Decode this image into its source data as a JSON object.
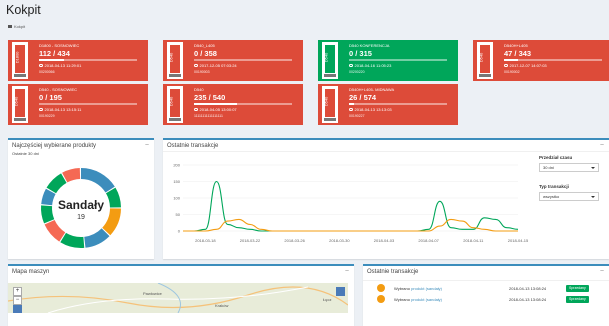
{
  "page": {
    "title": "Kokpit",
    "breadcrumb": "Kokpit"
  },
  "tiles": [
    {
      "color": "red",
      "code": "D1800",
      "name": "D1800 - SOSNOWIEC",
      "count": "112 / 434",
      "fill": 0.26,
      "timestamp": "2018-04-13 11:29:01",
      "id": "00200066"
    },
    {
      "color": "red",
      "code": "D540",
      "name": "D540_L405",
      "count": "0 / 358",
      "fill": 0.0,
      "timestamp": "2017-12-05 07:03:24",
      "id": "00190003"
    },
    {
      "color": "green",
      "code": "D540",
      "name": "D540 KONFERENCJA",
      "count": "0 / 315",
      "fill": 0.0,
      "timestamp": "2018-04-16 11:05:23",
      "id": "00200220"
    },
    {
      "color": "red",
      "code": "D540",
      "name": "D540H+L405",
      "count": "47 / 343",
      "fill": 0.14,
      "timestamp": "2017-12-07 14:07:03",
      "id": "00190002"
    },
    {
      "color": "red",
      "code": "D540",
      "name": "D540 - SOSNOWIEC",
      "count": "0 / 195",
      "fill": 0.0,
      "timestamp": "2018-04-13 13:15:11",
      "id": "00190229"
    },
    {
      "color": "red",
      "code": "D540",
      "name": "D540",
      "count": "235 / 540",
      "fill": 0.44,
      "timestamp": "2018-04-05 13:00:07",
      "id": "11111111111111111"
    },
    {
      "color": "red",
      "code": "D540",
      "name": "D540H+L405- MIDNAWA",
      "count": "26 / 574",
      "fill": 0.05,
      "timestamp": "2018-04-13 13:13:03",
      "id": "00190227"
    }
  ],
  "popular": {
    "title": "Najczęściej wybierane produkty",
    "subtitle": "Ostatnie 30 dni",
    "center_label": "Sandały",
    "center_value": "19",
    "segments": [
      {
        "value": 19,
        "color": "#3c8dbc"
      },
      {
        "value": 10,
        "color": "#00a65a"
      },
      {
        "value": 14,
        "color": "#f39c12"
      },
      {
        "value": 13,
        "color": "#3c8dbc"
      },
      {
        "value": 12,
        "color": "#00a65a"
      },
      {
        "value": 11,
        "color": "#f56954"
      },
      {
        "value": 9,
        "color": "#00a65a"
      },
      {
        "value": 8,
        "color": "#3c8dbc"
      },
      {
        "value": 10,
        "color": "#00a65a"
      },
      {
        "value": 9,
        "color": "#f56954"
      }
    ],
    "collapse_label": "−"
  },
  "transactions_chart": {
    "title": "Ostatnie transakcje",
    "collapse_label": "−",
    "filters": {
      "period_label": "Przedział czasu",
      "period_value": "30 dni",
      "type_label": "Typ transakcji",
      "type_value": "wszystko"
    }
  },
  "chart_data": {
    "type": "line",
    "x": [
      "2018-03-16",
      "2018-03-17",
      "2018-03-18",
      "2018-03-19",
      "2018-03-20",
      "2018-03-21",
      "2018-03-22",
      "2018-03-23",
      "2018-03-24",
      "2018-03-25",
      "2018-03-26",
      "2018-03-27",
      "2018-03-28",
      "2018-03-29",
      "2018-03-30",
      "2018-03-31",
      "2018-04-01",
      "2018-04-02",
      "2018-04-03",
      "2018-04-04",
      "2018-04-05",
      "2018-04-06",
      "2018-04-07",
      "2018-04-08",
      "2018-04-09",
      "2018-04-10",
      "2018-04-11",
      "2018-04-12",
      "2018-04-13",
      "2018-04-14",
      "2018-04-15"
    ],
    "tick_labels": [
      "2018-03-18",
      "2018-03-22",
      "2018-03-26",
      "2018-03-30",
      "2018-04-03",
      "2018-04-07",
      "2018-04-11",
      "2018-04-15"
    ],
    "yticks": [
      0,
      50,
      100,
      150,
      200
    ],
    "ylim": [
      0,
      200
    ],
    "series": [
      {
        "color": "#00a65a",
        "values": [
          0,
          0,
          5,
          150,
          20,
          10,
          5,
          0,
          0,
          0,
          0,
          0,
          0,
          0,
          0,
          0,
          0,
          0,
          0,
          0,
          0,
          0,
          5,
          90,
          10,
          5,
          5,
          40,
          35,
          10,
          5
        ]
      },
      {
        "color": "#f39c12",
        "values": [
          0,
          0,
          0,
          5,
          30,
          35,
          20,
          5,
          0,
          0,
          0,
          0,
          0,
          0,
          0,
          0,
          0,
          0,
          0,
          0,
          0,
          0,
          0,
          15,
          35,
          30,
          10,
          5,
          0,
          0,
          0
        ]
      }
    ],
    "grid": true
  },
  "map": {
    "title": "Mapa maszyn",
    "collapse_label": "−",
    "zoom_in": "+",
    "zoom_out": "−",
    "places": [
      "Pawłowice",
      "Kraków",
      "Łęcz"
    ]
  },
  "recent": {
    "title": "Ostatnie transakcje",
    "collapse_label": "−",
    "rows": [
      {
        "prefix": "Wybrano",
        "link": "produkt (sandały)",
        "date": "2018-04-13 13:08:24",
        "status": "Sprzedany"
      },
      {
        "prefix": "Wybrano",
        "link": "produkt (sandały)",
        "date": "2018-04-13 13:08:24",
        "status": "Sprzedany"
      }
    ]
  }
}
